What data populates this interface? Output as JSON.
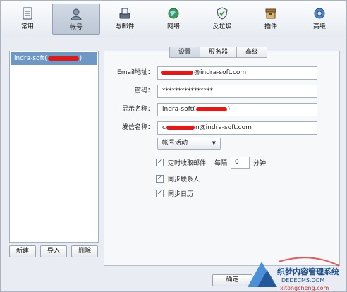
{
  "toolbar": {
    "items": [
      {
        "label": "常用",
        "icon": "general-icon"
      },
      {
        "label": "帐号",
        "icon": "account-icon"
      },
      {
        "label": "写邮件",
        "icon": "compose-icon"
      },
      {
        "label": "网络",
        "icon": "network-icon"
      },
      {
        "label": "反垃圾",
        "icon": "antispam-icon"
      },
      {
        "label": "插件",
        "icon": "plugin-icon"
      },
      {
        "label": "高级",
        "icon": "advanced-icon"
      }
    ],
    "active_index": 1
  },
  "account_list": {
    "items": [
      {
        "label_prefix": "indra-soft(",
        "label_suffix": ")"
      }
    ]
  },
  "account_buttons": {
    "new": "新建",
    "import": "导入",
    "delete": "删除"
  },
  "tabs": {
    "settings": "设置",
    "server": "服务器",
    "advanced": "高级"
  },
  "form": {
    "email_label": "Email地址：",
    "email_suffix": "@indra-soft.com",
    "password_label": "密码：",
    "password_value": "****************",
    "display_name_label": "显示名称：",
    "display_name_prefix": "indra-soft(",
    "display_name_suffix": ")",
    "sender_name_label": "发信名称：",
    "sender_prefix": "c",
    "sender_suffix": "n@indra-soft.com",
    "account_activity_select": "帐号活动",
    "timed_fetch_label": "定时收取邮件",
    "every_label": "每隔",
    "interval_value": "0",
    "minutes_label": "分钟",
    "sync_contacts_label": "同步联系人",
    "sync_calendar_label": "同步日历"
  },
  "footer": {
    "ok": "确定"
  },
  "watermark": {
    "line1": "织梦内容管理系统",
    "line2": "DEDECMS.COM",
    "line3": "xitongcheng.com"
  },
  "colors": {
    "selection": "#6f97c4",
    "redaction": "#e51717",
    "check_accent": "#2b5fa0"
  }
}
